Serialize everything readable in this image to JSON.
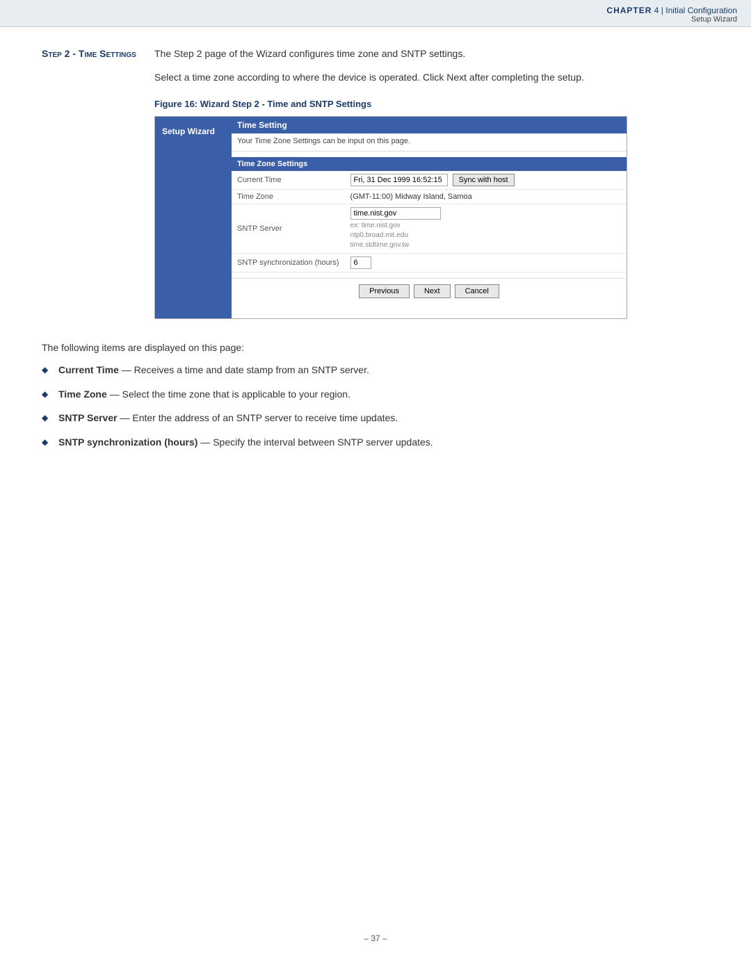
{
  "header": {
    "chapter_label": "Chapter",
    "chapter_number": "4",
    "chapter_pipe": "|",
    "chapter_title": "Initial Configuration",
    "section_title": "Setup Wizard"
  },
  "step": {
    "label": "Step 2 - Time Settings",
    "description": "The Step 2 page of the Wizard configures time zone and SNTP settings.",
    "body": "Select a time zone according to where the device is operated. Click Next after completing the setup."
  },
  "figure": {
    "caption": "Figure 16:  Wizard Step 2 - Time and SNTP Settings"
  },
  "wizard": {
    "sidebar_label": "Setup Wizard",
    "time_setting_title": "Time Setting",
    "time_setting_desc": "Your Time Zone Settings can be input on this page.",
    "time_zone_settings_title": "Time Zone Settings",
    "current_time_label": "Current Time",
    "current_time_value": "Fri, 31 Dec 1999 16:52:15",
    "sync_with_host_label": "Sync with host",
    "time_zone_label": "Time Zone",
    "time_zone_value": "(GMT-11:00) Midway Island, Samoa",
    "sntp_server_label": "SNTP Server",
    "sntp_server_value": "time.nist.gov",
    "sntp_example1": "ex: time.nist.gov",
    "sntp_example2": "ntp0.broad.mit.edu",
    "sntp_example3": "time.stdtime.gov.tw",
    "sntp_sync_label": "SNTP synchronization (hours)",
    "sntp_sync_value": "6",
    "btn_previous": "Previous",
    "btn_next": "Next",
    "btn_cancel": "Cancel"
  },
  "body": {
    "intro": "The following items are displayed on this page:",
    "bullets": [
      {
        "term": "Current Time",
        "dash": "—",
        "text": "Receives a time and date stamp from an SNTP server."
      },
      {
        "term": "Time Zone",
        "dash": "— ",
        "text": "Select the time zone that is applicable to your region."
      },
      {
        "term": "SNTP Server",
        "dash": "—",
        "text": "Enter the address of an SNTP server to receive time updates."
      },
      {
        "term": "SNTP synchronization (hours)",
        "dash": "—",
        "text": "Specify the interval between SNTP server updates."
      }
    ]
  },
  "footer": {
    "page_number": "– 37 –"
  }
}
